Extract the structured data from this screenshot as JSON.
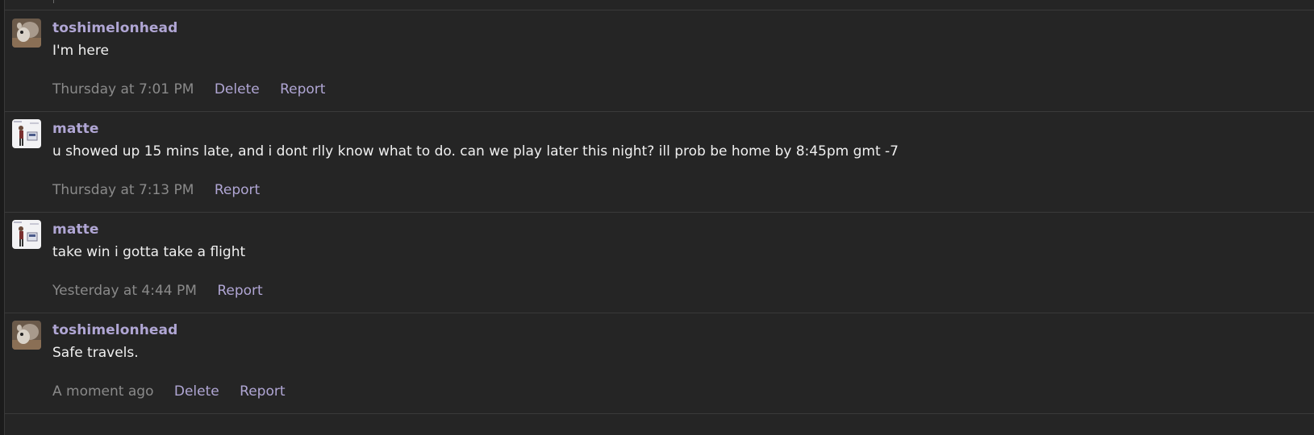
{
  "messages": [
    {
      "avatar": "squirrel-avatar",
      "username": "toshimelonhead",
      "text": "I'm here",
      "time": "Thursday at 7:01 PM",
      "actions": [
        "Delete",
        "Report"
      ]
    },
    {
      "avatar": "character-avatar",
      "username": "matte",
      "text": "u showed up 15 mins late, and i dont rlly know what to do. can we play later this night? ill prob be home by 8:45pm gmt -7",
      "time": "Thursday at 7:13 PM",
      "actions": [
        "Report"
      ]
    },
    {
      "avatar": "character-avatar",
      "username": "matte",
      "text": "take win i gotta take a flight",
      "time": "Yesterday at 4:44 PM",
      "actions": [
        "Report"
      ]
    },
    {
      "avatar": "squirrel-avatar",
      "username": "toshimelonhead",
      "text": "Safe travels.",
      "time": "A moment ago",
      "actions": [
        "Delete",
        "Report"
      ]
    }
  ],
  "colors": {
    "background": "#252525",
    "username": "#b0a6d4",
    "action_link": "#b0a6d4",
    "timestamp": "#8a8a8a",
    "message_text": "#f0f0f0",
    "divider": "#3a3a3a"
  }
}
